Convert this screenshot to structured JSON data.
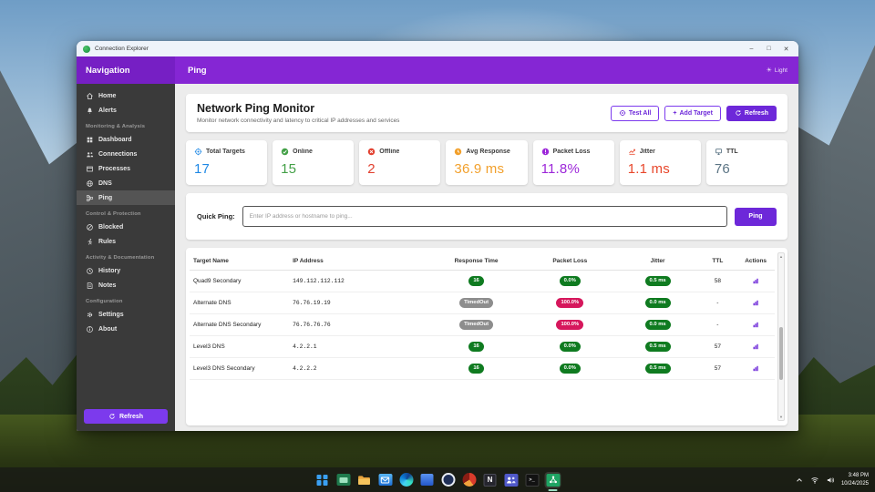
{
  "colors": {
    "accent_purple": "#7c3aed",
    "header_purple": "#8526d4",
    "sidebar_bg": "#3a3a3a",
    "badge_green": "#0f7b20",
    "badge_red": "#d6175c",
    "badge_gray": "#8d8d8d",
    "stat_blue": "#1e88e5",
    "stat_green": "#43a047",
    "stat_red": "#e2402f",
    "stat_orange": "#f2a02c",
    "stat_purple": "#9c27d9",
    "stat_deep_orange": "#e8472b",
    "stat_slate": "#5b7484"
  },
  "window": {
    "titlebar": {
      "title": "Connection Explorer",
      "minimize": "–",
      "maximize": "□",
      "close": "✕"
    },
    "header": {
      "nav_title": "Navigation",
      "page_title": "Ping",
      "theme_label": "Light"
    },
    "sidebar": {
      "groups": [
        {
          "header": "",
          "items": [
            {
              "label": "Home",
              "icon": "home-icon"
            },
            {
              "label": "Alerts",
              "icon": "bell-icon"
            }
          ]
        },
        {
          "header": "Monitoring & Analysis",
          "items": [
            {
              "label": "Dashboard",
              "icon": "dashboard-icon"
            },
            {
              "label": "Connections",
              "icon": "connections-icon"
            },
            {
              "label": "Processes",
              "icon": "processes-icon"
            },
            {
              "label": "DNS",
              "icon": "dns-icon"
            },
            {
              "label": "Ping",
              "icon": "ping-icon",
              "selected": true
            }
          ]
        },
        {
          "header": "Control & Protection",
          "items": [
            {
              "label": "Blocked",
              "icon": "blocked-icon"
            },
            {
              "label": "Rules",
              "icon": "rules-icon"
            }
          ]
        },
        {
          "header": "Activity & Documentation",
          "items": [
            {
              "label": "History",
              "icon": "history-icon"
            },
            {
              "label": "Notes",
              "icon": "notes-icon"
            }
          ]
        },
        {
          "header": "Configuration",
          "items": [
            {
              "label": "Settings",
              "icon": "settings-icon"
            },
            {
              "label": "About",
              "icon": "about-icon"
            }
          ]
        }
      ],
      "refresh_button": "Refresh"
    },
    "main": {
      "page_header": {
        "title": "Network Ping Monitor",
        "subtitle": "Monitor network connectivity and latency to critical IP addresses and services",
        "buttons": [
          {
            "label": "Test All",
            "icon": "target-icon"
          },
          {
            "label": "Add Target",
            "plus": "+",
            "icon": "plus-icon"
          },
          {
            "label": "Refresh",
            "icon": "refresh-icon"
          }
        ]
      },
      "stats": [
        {
          "label": "Total Targets",
          "value": "17",
          "icon": "target-icon",
          "style": "blue"
        },
        {
          "label": "Online",
          "value": "15",
          "icon": "check-circle-icon",
          "style": "green"
        },
        {
          "label": "Offline",
          "value": "2",
          "icon": "x-circle-icon",
          "style": "red"
        },
        {
          "label": "Avg Response",
          "value": "36.9 ms",
          "icon": "clock-icon",
          "style": "orange"
        },
        {
          "label": "Packet Loss",
          "value": "11.8%",
          "icon": "alert-circle-icon",
          "style": "purple"
        },
        {
          "label": "Jitter",
          "value": "1.1 ms",
          "icon": "line-chart-icon",
          "style": "deep-orange"
        },
        {
          "label": "TTL",
          "value": "76",
          "icon": "monitor-icon",
          "style": "slate"
        }
      ],
      "quick_ping": {
        "label": "Quick Ping:",
        "placeholder": "Enter IP address or hostname to ping...",
        "button": "Ping"
      },
      "table": {
        "columns": [
          "Target Name",
          "IP Address",
          "Response Time",
          "Packet Loss",
          "Jitter",
          "TTL",
          "Actions"
        ],
        "rows": [
          {
            "name": "Quad9 Secondary",
            "ip": "149.112.112.112",
            "response": {
              "text": "16",
              "style": "green"
            },
            "loss": {
              "text": "0.0%",
              "style": "green"
            },
            "jitter": {
              "text": "0.5 ms",
              "style": "green"
            },
            "ttl": "58"
          },
          {
            "name": "Alternate DNS",
            "ip": "76.76.19.19",
            "response": {
              "text": "TimedOut",
              "style": "gray"
            },
            "loss": {
              "text": "100.0%",
              "style": "red"
            },
            "jitter": {
              "text": "0.0 ms",
              "style": "green"
            },
            "ttl": "-"
          },
          {
            "name": "Alternate DNS Secondary",
            "ip": "76.76.76.76",
            "response": {
              "text": "TimedOut",
              "style": "gray"
            },
            "loss": {
              "text": "100.0%",
              "style": "red"
            },
            "jitter": {
              "text": "0.0 ms",
              "style": "green"
            },
            "ttl": "-"
          },
          {
            "name": "Level3 DNS",
            "ip": "4.2.2.1",
            "response": {
              "text": "16",
              "style": "green"
            },
            "loss": {
              "text": "0.0%",
              "style": "green"
            },
            "jitter": {
              "text": "0.5 ms",
              "style": "green"
            },
            "ttl": "57"
          },
          {
            "name": "Level3 DNS Secondary",
            "ip": "4.2.2.2",
            "response": {
              "text": "16",
              "style": "green"
            },
            "loss": {
              "text": "0.0%",
              "style": "green"
            },
            "jitter": {
              "text": "0.5 ms",
              "style": "green"
            },
            "ttl": "57"
          }
        ]
      }
    }
  },
  "taskbar": {
    "icons": [
      "start",
      "screen-app",
      "file-explorer",
      "mail",
      "edge",
      "blue-box",
      "ring-badge",
      "pie-chart",
      "notes-app",
      "teams",
      "terminal",
      "connection-explorer"
    ],
    "icons_text": {
      "notes_app": "N",
      "terminal": ">_"
    },
    "tray": {
      "time": "3:48 PM",
      "date": "10/24/2025"
    }
  }
}
